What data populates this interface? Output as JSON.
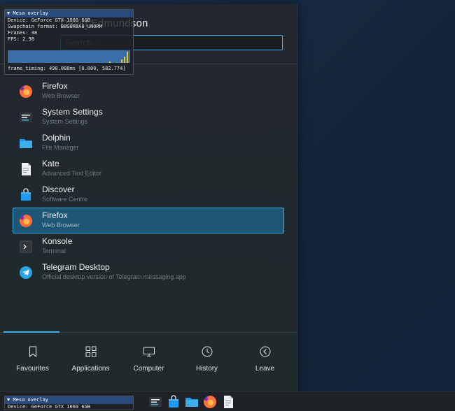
{
  "header": {
    "user_name": "David Edmundson",
    "search_placeholder": "Search..."
  },
  "apps": [
    {
      "name": "Firefox",
      "description": "Web Browser",
      "icon": "firefox-icon",
      "selected": false
    },
    {
      "name": "System Settings",
      "description": "System Settings",
      "icon": "system-settings-icon",
      "selected": false
    },
    {
      "name": "Dolphin",
      "description": "File Manager",
      "icon": "folder-icon",
      "selected": false
    },
    {
      "name": "Kate",
      "description": "Advanced Text Editor",
      "icon": "text-editor-icon",
      "selected": false
    },
    {
      "name": "Discover",
      "description": "Software Centre",
      "icon": "shopping-bag-icon",
      "selected": false
    },
    {
      "name": "Firefox",
      "description": "Web Browser",
      "icon": "firefox-icon",
      "selected": true
    },
    {
      "name": "Konsole",
      "description": "Terminal",
      "icon": "terminal-icon",
      "selected": false
    },
    {
      "name": "Telegram Desktop",
      "description": "Official desktop version of Telegram messaging app",
      "icon": "telegram-icon",
      "selected": false
    }
  ],
  "footer": {
    "tabs": [
      {
        "label": "Favourites",
        "icon": "bookmark-icon",
        "active": true
      },
      {
        "label": "Applications",
        "icon": "grid-icon",
        "active": false
      },
      {
        "label": "Computer",
        "icon": "monitor-icon",
        "active": false
      },
      {
        "label": "History",
        "icon": "clock-icon",
        "active": false
      },
      {
        "label": "Leave",
        "icon": "arrow-left-circle-icon",
        "active": false
      }
    ]
  },
  "mesa_overlay": {
    "title": "▼ Mesa overlay",
    "device": "Device: GeForce GTX 1060 6GB",
    "swapchain": "Swapchain format: B8G8R8A8_UNORM",
    "frames": "Frames: 38",
    "fps": "FPS: 2.98",
    "frame_timing": "frame_timing: 498.088ms [0.000, 582.774]"
  },
  "mesa_overlay_bottom": {
    "title": "▼ Mesa overlay",
    "device": "Device: GeForce GTX 1060 6GB"
  },
  "taskbar": {
    "icons": [
      "system-settings-icon",
      "shopping-bag-icon",
      "folder-icon",
      "firefox-icon",
      "text-editor-icon"
    ]
  },
  "colors": {
    "accent": "#3daee9",
    "selection_bg": "#1e5775",
    "panel_bg": "#23282e",
    "desktop_bg": "#16263a"
  }
}
